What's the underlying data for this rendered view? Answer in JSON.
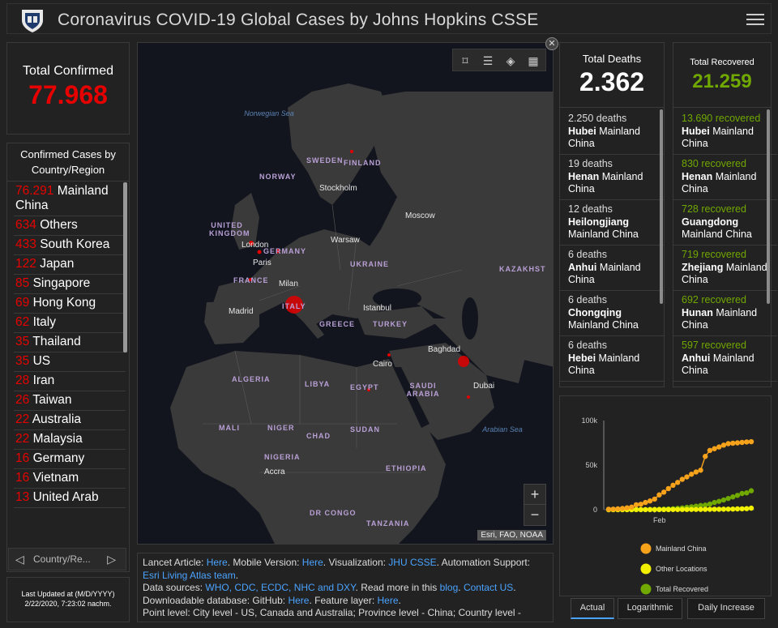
{
  "header": {
    "title": "Coronavirus COVID-19 Global Cases by Johns Hopkins CSSE"
  },
  "confirmed": {
    "label": "Total Confirmed",
    "value": "77.968"
  },
  "country_panel": {
    "header": "Confirmed Cases by Country/Region",
    "pager_label": "Country/Re...",
    "rows": [
      {
        "num": "76.291",
        "name": "Mainland China"
      },
      {
        "num": "634",
        "name": "Others"
      },
      {
        "num": "433",
        "name": "South Korea"
      },
      {
        "num": "122",
        "name": "Japan"
      },
      {
        "num": "85",
        "name": "Singapore"
      },
      {
        "num": "69",
        "name": "Hong Kong"
      },
      {
        "num": "62",
        "name": "Italy"
      },
      {
        "num": "35",
        "name": "Thailand"
      },
      {
        "num": "35",
        "name": "US"
      },
      {
        "num": "28",
        "name": "Iran"
      },
      {
        "num": "26",
        "name": "Taiwan"
      },
      {
        "num": "22",
        "name": "Australia"
      },
      {
        "num": "22",
        "name": "Malaysia"
      },
      {
        "num": "16",
        "name": "Germany"
      },
      {
        "num": "16",
        "name": "Vietnam"
      },
      {
        "num": "13",
        "name": "United Arab"
      }
    ]
  },
  "updated": {
    "label": "Last Updated at (M/D/YYYY)",
    "value": "2/22/2020, 7:23:02 nachm."
  },
  "map": {
    "countries": [
      "SWEDEN",
      "FINLAND",
      "NORWAY",
      "UNITED KINGDOM",
      "GERMANY",
      "FRANCE",
      "UKRAINE",
      "ITALY",
      "GREECE",
      "TURKEY",
      "KAZAKHST",
      "ALGERIA",
      "LIBYA",
      "EGYPT",
      "SAUDI ARABIA",
      "MALI",
      "NIGER",
      "CHAD",
      "SUDAN",
      "NIGERIA",
      "ETHIOPIA",
      "DR CONGO",
      "TANZANIA"
    ],
    "cities": [
      "Stockholm",
      "Moscow",
      "London",
      "Warsaw",
      "Paris",
      "Milan",
      "Madrid",
      "Istanbul",
      "Baghdad",
      "Cairo",
      "Dubai",
      "Accra"
    ],
    "seas": [
      "Norwegian Sea",
      "Arabian Sea"
    ],
    "attribution": "Esri, FAO, NOAA",
    "zoom_in": "+",
    "zoom_out": "−"
  },
  "info": {
    "line1_pre": "Lancet Article: ",
    "lancet_link": "Here",
    "mobile_pre": ". Mobile Version: ",
    "mobile_link": "Here",
    "viz_pre": ". Visualization: ",
    "viz_link": "JHU CSSE",
    "auto_pre": ". Automation Support: ",
    "auto_link": "Esri Living Atlas team",
    "auto_post": ".",
    "ds_pre": "Data sources: ",
    "ds_links": "WHO, CDC, ECDC, NHC and DXY",
    "ds_mid": ". Read more in this ",
    "blog_link": "blog",
    "ds_sep": ". ",
    "contact_link": "Contact US",
    "ds_post": ".",
    "dl_pre": "Downloadable database: GitHub: ",
    "gh_link": "Here",
    "fl_pre": ". Feature layer: ",
    "fl_link": "Here",
    "fl_post": ".",
    "point_level": "Point level: City level - US, Canada and Australia; Province level - China; Country level -"
  },
  "deaths": {
    "label": "Total Deaths",
    "value": "2.362",
    "rows": [
      {
        "count": "2.250 deaths",
        "province": "Hubei",
        "region": "Mainland China"
      },
      {
        "count": "19 deaths",
        "province": "Henan",
        "region": "Mainland China"
      },
      {
        "count": "12 deaths",
        "province": "Heilongjiang",
        "region": "Mainland China"
      },
      {
        "count": "6 deaths",
        "province": "Anhui",
        "region": "Mainland China"
      },
      {
        "count": "6 deaths",
        "province": "Chongqing",
        "region": "Mainland China"
      },
      {
        "count": "6 deaths",
        "province": "Hebei",
        "region": "Mainland China"
      }
    ]
  },
  "recovered": {
    "label": "Total Recovered",
    "value": "21.259",
    "rows": [
      {
        "count": "13.690 recovered",
        "province": "Hubei",
        "region": "Mainland China"
      },
      {
        "count": "830 recovered",
        "province": "Henan",
        "region": "Mainland China"
      },
      {
        "count": "728 recovered",
        "province": "Guangdong",
        "region": "Mainland China"
      },
      {
        "count": "719 recovered",
        "province": "Zhejiang",
        "region": "Mainland China"
      },
      {
        "count": "692 recovered",
        "province": "Hunan",
        "region": "Mainland China"
      },
      {
        "count": "597 recovered",
        "province": "Anhui",
        "region": "Mainland China"
      }
    ]
  },
  "tabs": [
    "Actual",
    "Logarithmic",
    "Daily Increase"
  ],
  "colors": {
    "confirmed": "#e60000",
    "mainland": "#f7a21b",
    "other": "#f0f000",
    "recovered": "#70a800"
  },
  "chart_data": {
    "type": "line",
    "y_ticks": [
      "100k",
      "50k",
      "0"
    ],
    "ylim": [
      0,
      100000
    ],
    "x_ticks": [
      "Feb"
    ],
    "legend": [
      "Mainland China",
      "Other Locations",
      "Total Recovered"
    ],
    "x": [
      "1/22",
      "1/23",
      "1/24",
      "1/25",
      "1/26",
      "1/27",
      "1/28",
      "1/29",
      "1/30",
      "1/31",
      "2/1",
      "2/2",
      "2/3",
      "2/4",
      "2/5",
      "2/6",
      "2/7",
      "2/8",
      "2/9",
      "2/10",
      "2/11",
      "2/12",
      "2/13",
      "2/14",
      "2/15",
      "2/16",
      "2/17",
      "2/18",
      "2/19",
      "2/20",
      "2/21",
      "2/22"
    ],
    "series": [
      {
        "name": "Mainland China",
        "color": "#f7a21b",
        "values": [
          550,
          640,
          920,
          1400,
          2100,
          2900,
          5500,
          6100,
          8100,
          9800,
          11900,
          16600,
          19700,
          23700,
          27400,
          30600,
          34100,
          36800,
          39800,
          42300,
          44300,
          59800,
          66500,
          68400,
          70400,
          72400,
          74100,
          74600,
          75000,
          75500,
          76000,
          76300
        ]
      },
      {
        "name": "Other Locations",
        "color": "#f0f000",
        "values": [
          10,
          15,
          20,
          30,
          50,
          60,
          70,
          80,
          90,
          110,
          130,
          150,
          160,
          180,
          190,
          210,
          240,
          280,
          300,
          320,
          350,
          400,
          440,
          500,
          520,
          560,
          650,
          700,
          900,
          1000,
          1200,
          1700
        ]
      },
      {
        "name": "Total Recovered",
        "color": "#70a800",
        "values": [
          28,
          30,
          36,
          39,
          52,
          61,
          107,
          126,
          143,
          222,
          284,
          472,
          623,
          852,
          1124,
          1487,
          2011,
          2616,
          3244,
          3946,
          4683,
          5150,
          6295,
          8058,
          9395,
          10865,
          12583,
          14352,
          16121,
          18177,
          18890,
          21259
        ]
      }
    ]
  }
}
